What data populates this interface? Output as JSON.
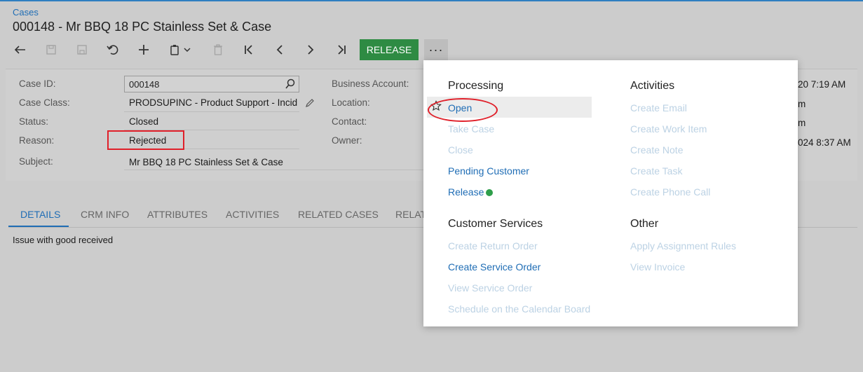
{
  "breadcrumb": "Cases",
  "title": "000148 - Mr BBQ 18 PC Stainless Set & Case",
  "toolbar": {
    "release_label": "RELEASE",
    "more_label": "···"
  },
  "form": {
    "case_id_label": "Case ID:",
    "case_id_value": "000148",
    "case_class_label": "Case Class:",
    "case_class_value": "PRODSUPINC - Product Support - Incide",
    "status_label": "Status:",
    "status_value": "Closed",
    "reason_label": "Reason:",
    "reason_value": "Rejected",
    "subject_label": "Subject:",
    "subject_value": "Mr BBQ 18 PC Stainless Set & Case",
    "business_account_label": "Business Account:",
    "location_label": "Location:",
    "contact_label": "Contact:",
    "owner_label": "Owner:",
    "right_values": [
      "20 7:19 AM",
      "m",
      "m",
      "024 8:37 AM"
    ]
  },
  "tabs": [
    "DETAILS",
    "CRM INFO",
    "ATTRIBUTES",
    "ACTIVITIES",
    "RELATED CASES",
    "RELAT"
  ],
  "details_text": "Issue with good received",
  "menu": {
    "processing": {
      "title": "Processing",
      "items": [
        "Open",
        "Take Case",
        "Close",
        "Pending Customer",
        "Release"
      ]
    },
    "activities": {
      "title": "Activities",
      "items": [
        "Create Email",
        "Create Work Item",
        "Create Note",
        "Create Task",
        "Create Phone Call"
      ]
    },
    "customer_services": {
      "title": "Customer Services",
      "items": [
        "Create Return Order",
        "Create Service Order",
        "View Service Order",
        "Schedule on the Calendar Board"
      ]
    },
    "other": {
      "title": "Other",
      "items": [
        "Apply Assignment Rules",
        "View Invoice"
      ]
    }
  },
  "colors": {
    "accent": "#1f6db5",
    "release_button": "#2e8b43",
    "highlight_red": "#e0202a",
    "disabled_item": "#bcd2e4"
  }
}
